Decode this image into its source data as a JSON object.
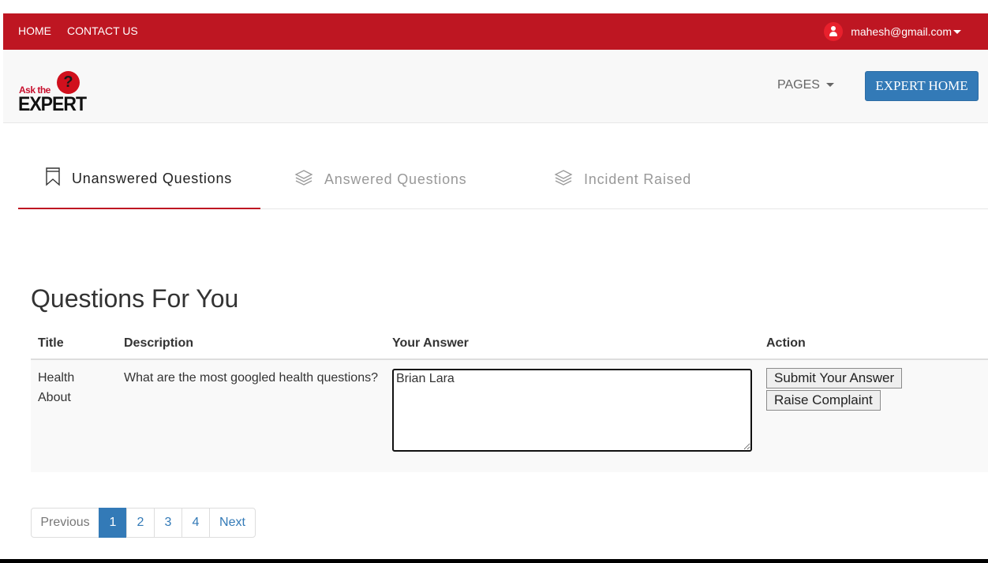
{
  "topbar": {
    "links": [
      "HOME",
      "CONTACT US"
    ],
    "user_email": "mahesh@gmail.com",
    "bg_color": "#be1622"
  },
  "navbar": {
    "logo": {
      "line1": "Ask the",
      "line2": "EXPERT",
      "bubble": "?"
    },
    "pages_label": "PAGES",
    "expert_home_label": "EXPERT HOME"
  },
  "tabs": [
    {
      "label": "Unanswered Questions",
      "icon": "bookmark-icon",
      "active": true
    },
    {
      "label": "Answered Questions",
      "icon": "layers-icon",
      "active": false
    },
    {
      "label": "Incident Raised",
      "icon": "layers-icon",
      "active": false
    }
  ],
  "section_title": "Questions For You",
  "table": {
    "headers": [
      "Title",
      "Description",
      "Your Answer",
      "Action"
    ],
    "rows": [
      {
        "title_line1": "Health",
        "title_line2": "About",
        "description": "What are the most googled health questions?",
        "answer": "Brian Lara",
        "submit_label": "Submit Your Answer",
        "complaint_label": "Raise Complaint"
      }
    ]
  },
  "pagination": {
    "previous": "Previous",
    "pages": [
      "1",
      "2",
      "3",
      "4"
    ],
    "current": "1",
    "next": "Next"
  }
}
